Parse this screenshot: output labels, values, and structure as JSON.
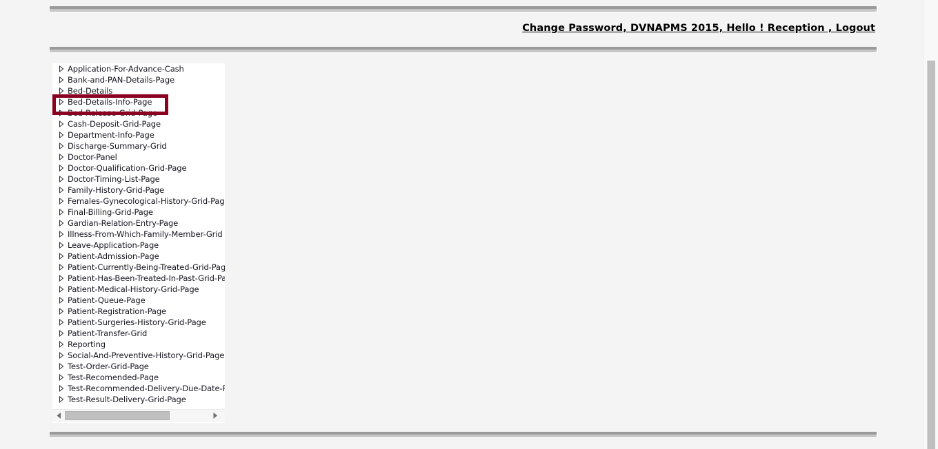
{
  "header": {
    "links_text": "Change Password, DVNAPMS 2015, Hello ! Reception , Logout",
    "parts": {
      "change_password": "Change Password",
      "app_name": "DVNAPMS 2015",
      "greeting": "Hello ! Reception",
      "logout": "Logout"
    }
  },
  "tree": {
    "highlighted_item": "Bed-Details-Info-Page",
    "highlight_color": "#8b0020",
    "items": [
      {
        "label": "Application-For-Advance-Cash"
      },
      {
        "label": "Bank-and-PAN-Details-Page"
      },
      {
        "label": "Bed-Details"
      },
      {
        "label": "Bed-Details-Info-Page"
      },
      {
        "label": "Bed-Release-Grid-Page"
      },
      {
        "label": "Cash-Deposit-Grid-Page"
      },
      {
        "label": "Department-Info-Page"
      },
      {
        "label": "Discharge-Summary-Grid"
      },
      {
        "label": "Doctor-Panel"
      },
      {
        "label": "Doctor-Qualification-Grid-Page"
      },
      {
        "label": "Doctor-Timing-List-Page"
      },
      {
        "label": "Family-History-Grid-Page"
      },
      {
        "label": "Females-Gynecological-History-Grid-Page"
      },
      {
        "label": "Final-Billing-Grid-Page"
      },
      {
        "label": "Gardian-Relation-Entry-Page"
      },
      {
        "label": "Illness-From-Which-Family-Member-Grid"
      },
      {
        "label": "Leave-Application-Page"
      },
      {
        "label": "Patient-Admission-Page"
      },
      {
        "label": "Patient-Currently-Being-Treated-Grid-Page"
      },
      {
        "label": "Patient-Has-Been-Treated-In-Past-Grid-Page"
      },
      {
        "label": "Patient-Medical-History-Grid-Page"
      },
      {
        "label": "Patient-Queue-Page"
      },
      {
        "label": "Patient-Registration-Page"
      },
      {
        "label": "Patient-Surgeries-History-Grid-Page"
      },
      {
        "label": "Patient-Transfer-Grid"
      },
      {
        "label": "Reporting"
      },
      {
        "label": "Social-And-Preventive-History-Grid-Page"
      },
      {
        "label": "Test-Order-Grid-Page"
      },
      {
        "label": "Test-Recomended-Page"
      },
      {
        "label": "Test-Recommended-Delivery-Due-Date-Page"
      },
      {
        "label": "Test-Result-Delivery-Grid-Page"
      }
    ]
  },
  "scrollbars": {
    "horizontal_left_arrow": "left-arrow",
    "horizontal_right_arrow": "right-arrow"
  }
}
